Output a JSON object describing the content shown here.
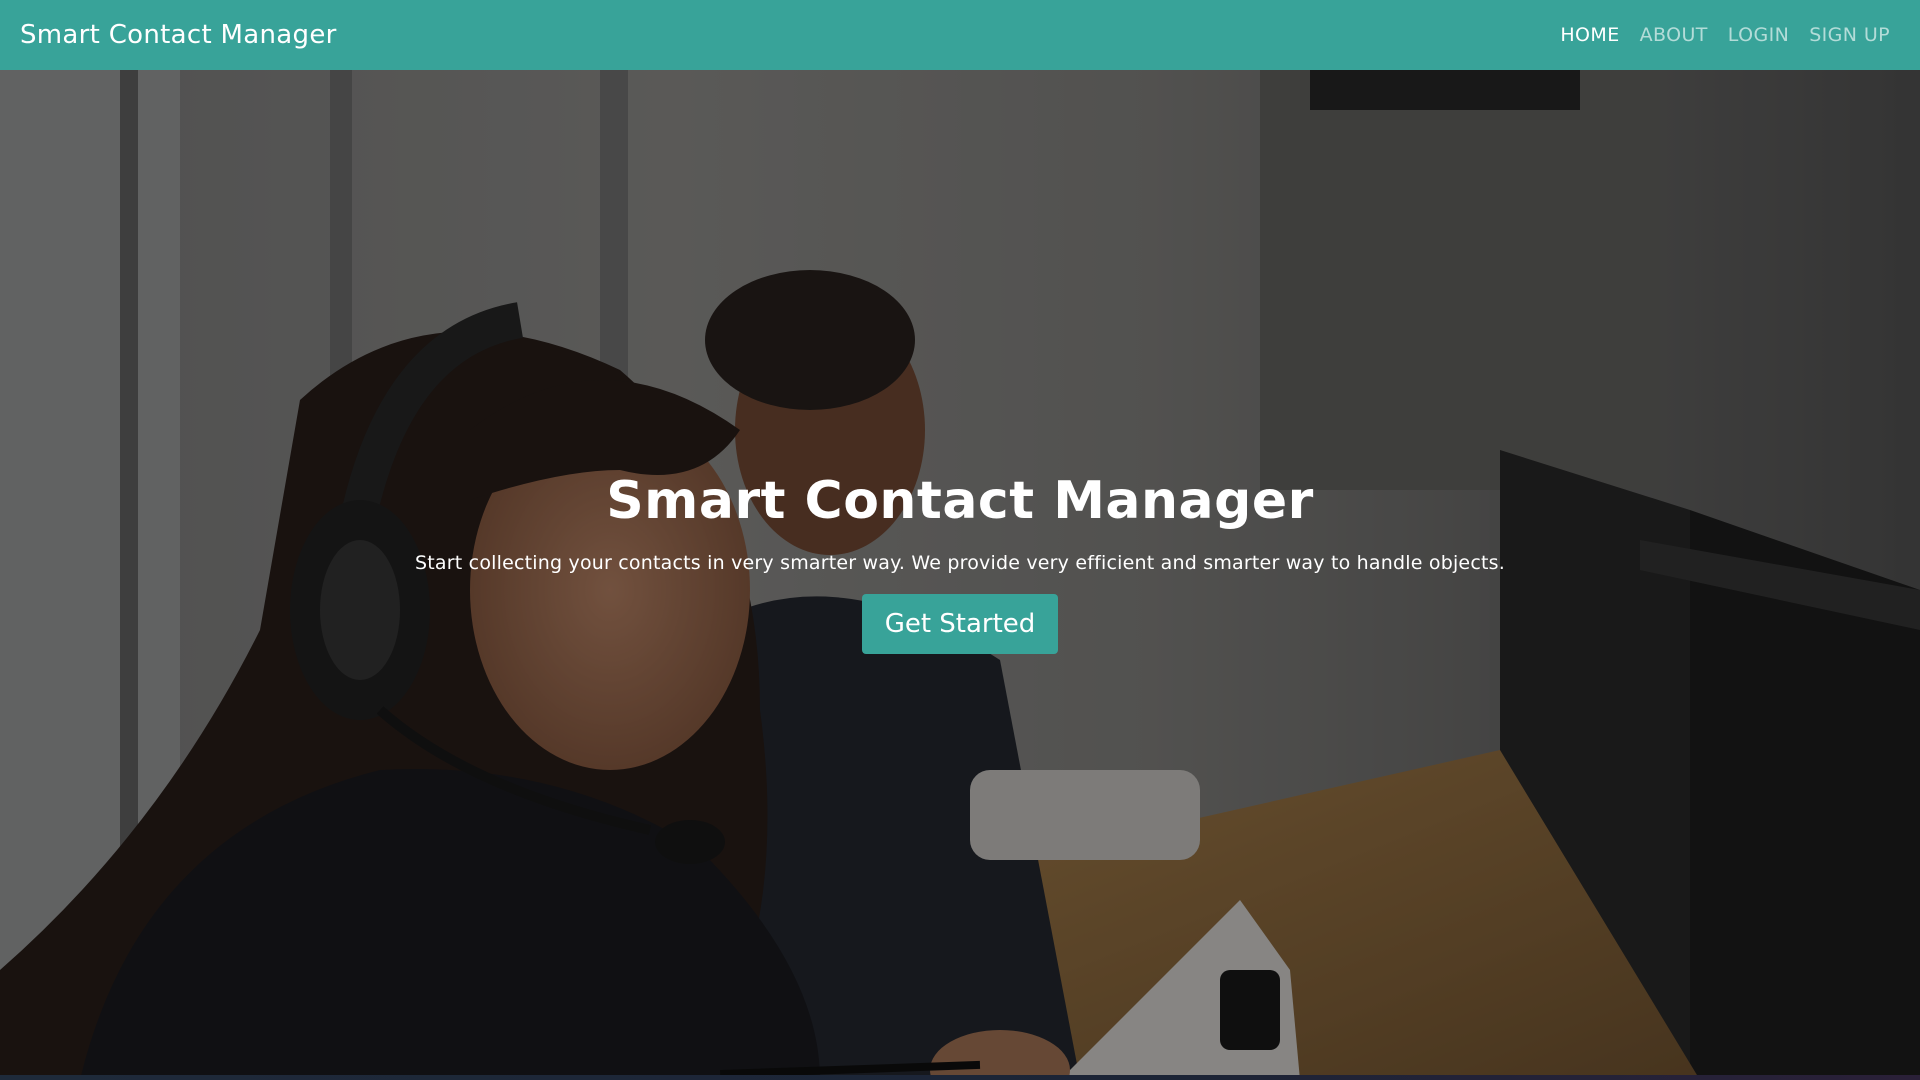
{
  "navbar": {
    "brand": "Smart Contact Manager",
    "links": [
      {
        "label": "HOME",
        "active": true
      },
      {
        "label": "ABOUT",
        "active": false
      },
      {
        "label": "LOGIN",
        "active": false
      },
      {
        "label": "SIGN UP",
        "active": false
      }
    ]
  },
  "hero": {
    "title": "Smart Contact Manager",
    "subtitle": "Start collecting your contacts in very smarter way. We provide very efficient and smarter way to handle objects.",
    "cta_label": "Get Started",
    "background_description_icon": "photo-call-center-agents"
  },
  "colors": {
    "accent": "#38a399",
    "text": "#ffffff"
  }
}
